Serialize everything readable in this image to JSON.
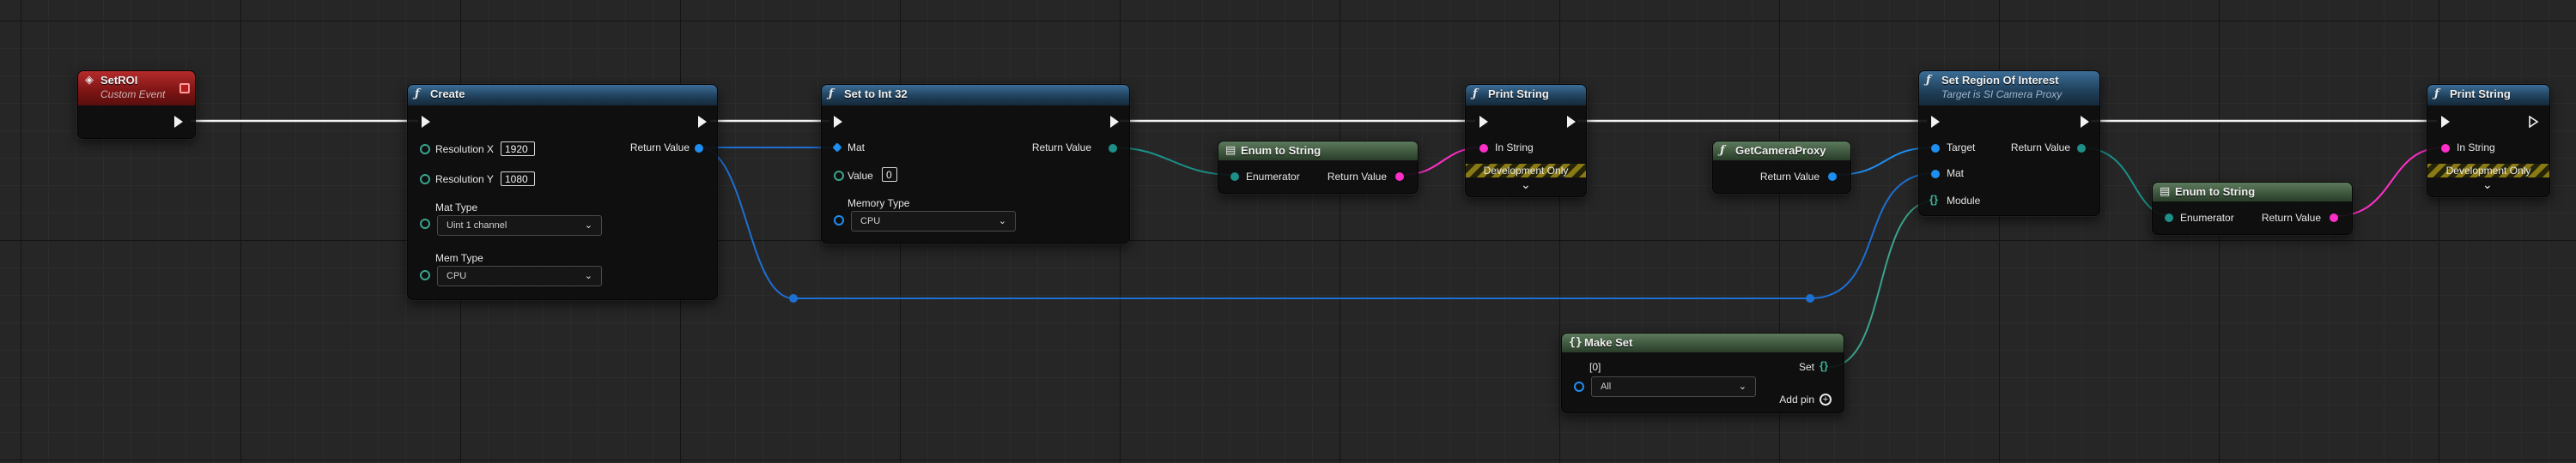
{
  "colors": {
    "background": "#262626",
    "exec_wire": "#f2f2f2",
    "struct_wire_blue": "#1e6fd2",
    "object_wire_teal": "#1c8f88",
    "string_wire_pink": "#ff2fc8",
    "set_wire_green": "#3aa38d",
    "event_header": "#8b1a1a",
    "function_header": "#2b5276",
    "pure_header": "#3d5f38"
  },
  "nodes": {
    "setroi": {
      "title": "SetROI",
      "subtitle": "Custom Event"
    },
    "create": {
      "title": "Create",
      "resx_label": "Resolution X",
      "resx_value": "1920",
      "resy_label": "Resolution Y",
      "resy_value": "1080",
      "mattype_label": "Mat Type",
      "mattype_value": "Uint 1 channel",
      "memtype_label": "Mem Type",
      "memtype_value": "CPU",
      "return_label": "Return Value"
    },
    "setint": {
      "title": "Set to Int 32",
      "mat_label": "Mat",
      "value_label": "Value",
      "value_value": "0",
      "memtype_label": "Memory Type",
      "memtype_value": "CPU",
      "return_label": "Return Value"
    },
    "enum1": {
      "title": "Enum to String",
      "in_label": "Enumerator",
      "return_label": "Return Value"
    },
    "print1": {
      "title": "Print String",
      "in_label": "In String",
      "dev_label": "Development Only"
    },
    "getcam": {
      "title": "GetCameraProxy",
      "return_label": "Return Value"
    },
    "setregion": {
      "title": "Set Region Of Interest",
      "subtitle": "Target is SI Camera Proxy",
      "target_label": "Target",
      "mat_label": "Mat",
      "module_label": "Module",
      "return_label": "Return Value"
    },
    "enum2": {
      "title": "Enum to String",
      "in_label": "Enumerator",
      "return_label": "Return Value"
    },
    "print2": {
      "title": "Print String",
      "in_label": "In String",
      "dev_label": "Development Only"
    },
    "makeset": {
      "title": "Make Set",
      "index_label": "[0]",
      "set_label": "Set",
      "dropdown_value": "All",
      "addpin_label": "Add pin"
    }
  },
  "icons": {
    "function": "f-function-icon",
    "event": "event-diamond-icon",
    "pure": "document-icon",
    "expand": "chevron-down-icon",
    "makeset": "set-braces-icon",
    "addpin": "plus-circle-icon"
  }
}
